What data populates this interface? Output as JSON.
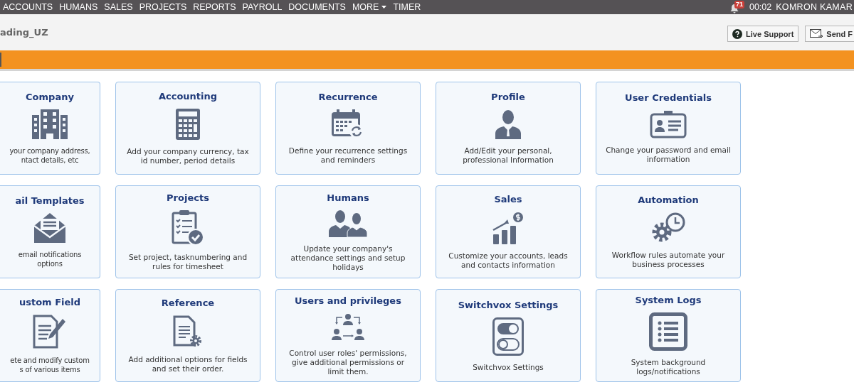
{
  "nav": {
    "items": [
      {
        "label": "ACCOUNTS",
        "dropdown": false
      },
      {
        "label": "HUMANS",
        "dropdown": false
      },
      {
        "label": "SALES",
        "dropdown": false
      },
      {
        "label": "PROJECTS",
        "dropdown": false
      },
      {
        "label": "REPORTS",
        "dropdown": false
      },
      {
        "label": "PAYROLL",
        "dropdown": false
      },
      {
        "label": "DOCUMENTS",
        "dropdown": false
      },
      {
        "label": "MORE",
        "dropdown": true
      },
      {
        "label": "TIMER",
        "dropdown": false
      }
    ],
    "notifications": "71",
    "timer": "00:02",
    "user": "KOMRON KAMAR"
  },
  "header": {
    "org": "ading_UZ",
    "buttons": [
      {
        "label": "Live Support",
        "kind": "help"
      },
      {
        "label": "Send F",
        "kind": "mail"
      }
    ]
  },
  "cards": [
    {
      "title": "Company",
      "description": "your company address,\nntact details, etc"
    },
    {
      "title": "Accounting",
      "description": "Add your company currency, tax id number, period details"
    },
    {
      "title": "Recurrence",
      "description": "Define your recurrence settings and reminders"
    },
    {
      "title": "Profile",
      "description": "Add/Edit your personal, professional Information"
    },
    {
      "title": "User Credentials",
      "description": "Change your password and email information"
    },
    {
      "title": "ail Templates",
      "description": "email notifications\noptions"
    },
    {
      "title": "Projects",
      "description": "Set project, tasknumbering and rules for timesheet"
    },
    {
      "title": "Humans",
      "description": "Update your company's attendance settings and setup holidays"
    },
    {
      "title": "Sales",
      "description": "Customize your accounts, leads and contacts information"
    },
    {
      "title": "Automation",
      "description": "Workflow rules automate your business processes"
    },
    {
      "title": "ustom Field",
      "description": "ete and modify custom\ns of various items"
    },
    {
      "title": "Reference",
      "description": "Add additional options for fields and set their order."
    },
    {
      "title": "Users and privileges",
      "description": "Control user roles' permissions, give additional permissions or limit them."
    },
    {
      "title": "Switchvox Settings",
      "description": "Switchvox Settings"
    },
    {
      "title": "System Logs",
      "description": "System background logs/notifications"
    }
  ]
}
